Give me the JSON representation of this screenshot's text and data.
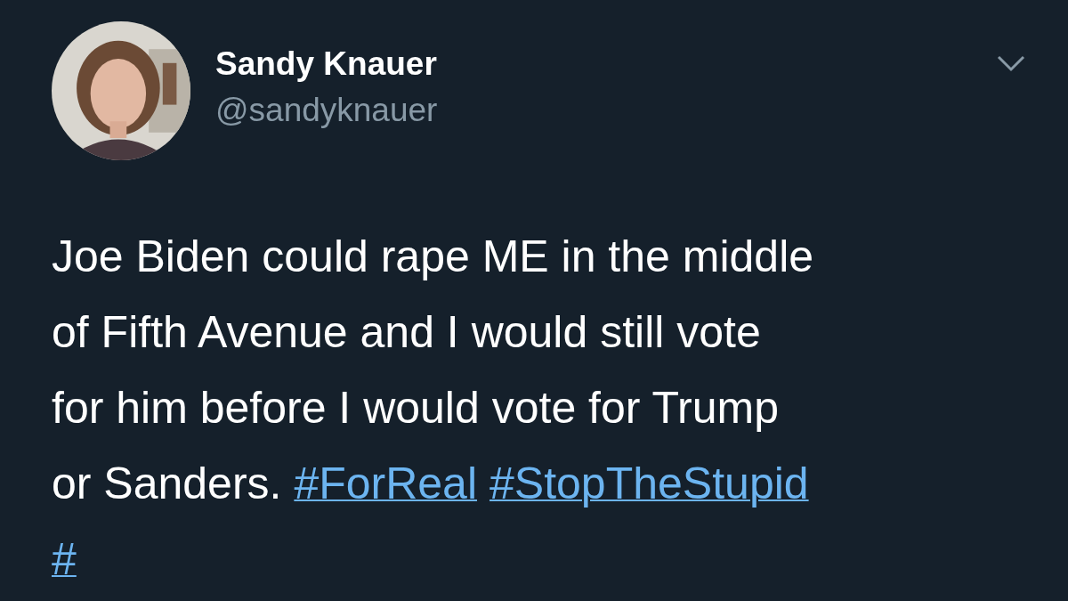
{
  "tweet": {
    "author": {
      "name": "Sandy Knauer",
      "handle": "@sandyknauer"
    },
    "menu": {
      "expanded": false
    },
    "lines": [
      [
        {
          "kind": "text",
          "text": "Joe Biden could rape ME in the middle"
        }
      ],
      [
        {
          "kind": "text",
          "text": "of Fifth Avenue and I would still vote"
        }
      ],
      [
        {
          "kind": "text",
          "text": "for him before I would vote for Trump"
        }
      ],
      [
        {
          "kind": "text",
          "text": "or Sanders. "
        },
        {
          "kind": "hashtag",
          "text": "#ForReal"
        },
        {
          "kind": "hashtag",
          "text": "#StopTheStupid"
        }
      ],
      [
        {
          "kind": "hashtag",
          "text": "#"
        }
      ]
    ]
  }
}
